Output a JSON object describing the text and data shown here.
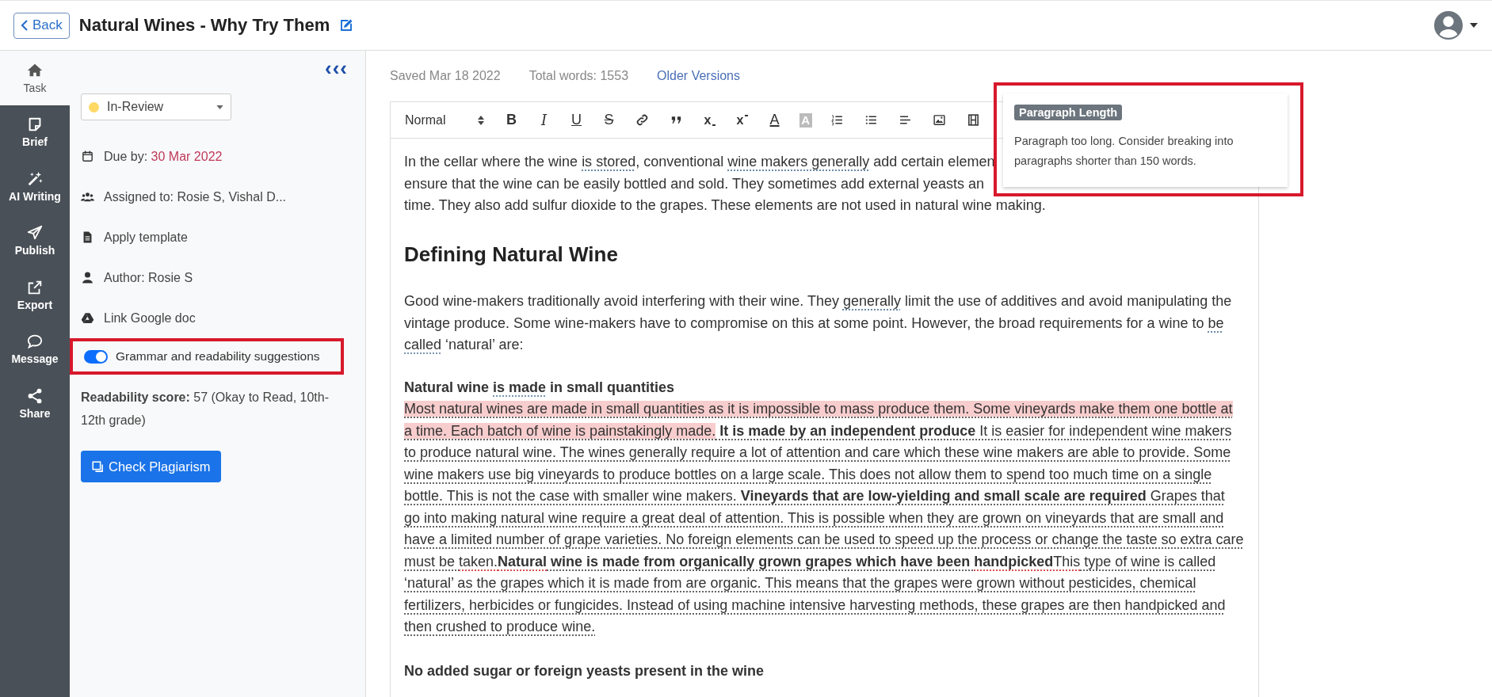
{
  "header": {
    "back_label": "Back",
    "title": "Natural Wines - Why Try Them"
  },
  "rail": [
    {
      "kind": "home",
      "label": "Task",
      "selected": true
    },
    {
      "kind": "note",
      "label": "Brief",
      "selected": false
    },
    {
      "kind": "wand",
      "label": "AI Writing",
      "selected": false
    },
    {
      "kind": "plane",
      "label": "Publish",
      "selected": false
    },
    {
      "kind": "export",
      "label": "Export",
      "selected": false
    },
    {
      "kind": "chat",
      "label": "Message",
      "selected": false
    },
    {
      "kind": "share",
      "label": "Share",
      "selected": false
    }
  ],
  "panel": {
    "collapse": "‹‹‹",
    "status": {
      "label": "In-Review",
      "color": "#ffd966"
    },
    "details": [
      {
        "kind": "calendar",
        "label": "Due by: ",
        "value": "30 Mar 2022"
      },
      {
        "kind": "users",
        "label": "Assigned to: Rosie S, Vishal D..."
      },
      {
        "kind": "file",
        "label": "Apply template"
      },
      {
        "kind": "user",
        "label": "Author: Rosie S"
      },
      {
        "kind": "drive",
        "label": "Link Google doc"
      }
    ],
    "suggestions": {
      "label": "Grammar and readability suggestions",
      "on": true,
      "framed": true
    },
    "readability": "**Readability score:** 57 (Okay to Read, 10th-12th grade)",
    "plagiarism_button": "Check Plagiarism"
  },
  "meta": {
    "saved": "Saved Mar 18 2022",
    "words": "Total words: 1553",
    "versions_link": "Older Versions"
  },
  "toolbar": [
    {
      "kind": "format",
      "label": "Normal"
    },
    {
      "kind": "bold",
      "glyph": "B"
    },
    {
      "kind": "italic",
      "glyph": "I"
    },
    {
      "kind": "underline",
      "glyph": "U"
    },
    {
      "kind": "strike",
      "glyph": "S"
    },
    {
      "kind": "link"
    },
    {
      "kind": "quote"
    },
    {
      "kind": "sub",
      "glyph": "x"
    },
    {
      "kind": "sup",
      "glyph": "x"
    },
    {
      "kind": "color",
      "glyph": "A"
    },
    {
      "kind": "background",
      "glyph": "A"
    },
    {
      "kind": "ol"
    },
    {
      "kind": "ul"
    },
    {
      "kind": "align"
    },
    {
      "kind": "image"
    },
    {
      "kind": "video"
    }
  ],
  "document": [
    {
      "kind": "lines",
      "segments": [
        {
          "kind": "plain",
          "text": "In the cellar where the wine "
        },
        {
          "kind": "hint",
          "text": "is stored"
        },
        {
          "kind": "plain",
          "text": ", conventional "
        },
        {
          "kind": "hint",
          "text": "wine makers generally"
        },
        {
          "kind": "plain",
          "text": " add certain elemen"
        },
        {
          "kind": "break"
        },
        {
          "kind": "plain",
          "text": "ensure that the wine can be easily bottled and sold. They sometimes add external yeasts an"
        },
        {
          "kind": "break"
        },
        {
          "kind": "plain",
          "text": "time. They also add sulfur dioxide to the grapes. These elements are not used in natural wine making."
        }
      ]
    },
    {
      "kind": "heading",
      "segments": [
        {
          "kind": "plain",
          "text": "Defining Natural Wine"
        }
      ]
    },
    {
      "kind": "paragraph",
      "underlined": false,
      "segments": [
        {
          "kind": "plain",
          "text": "Good wine-makers traditionally avoid interfering with their wine. They "
        },
        {
          "kind": "hint",
          "text": "generally"
        },
        {
          "kind": "plain",
          "text": " limit the use of additives and avoid manipulating the vintage produce. Some wine-makers have to compromise on this at some point. However, the broad requirements for a wine to "
        },
        {
          "kind": "hint",
          "text": "be called"
        },
        {
          "kind": "plain",
          "text": " ‘natural’ are:"
        }
      ]
    },
    {
      "kind": "subheading",
      "segments": [
        {
          "kind": "plain",
          "text": "Natural wine "
        },
        {
          "kind": "hint",
          "text": "is made"
        },
        {
          "kind": "plain",
          "text": " in small quantities"
        }
      ]
    },
    {
      "kind": "paragraph",
      "underlined": true,
      "segments": [
        {
          "kind": "highlight",
          "text": "Most natural wines are made in small quantities as it is impossible to mass produce them. Some vineyards make them one bottle at a time. Each batch of wine is painstakingly made."
        },
        {
          "kind": "bold",
          "text": " It is made by an independent produce"
        },
        {
          "kind": "plain",
          "text": " It is easier for independent wine makers to produce natural wine. The wines generally require a lot of attention and care which these wine makers are able to provide. Some wine makers use big vineyards to produce bottles on a large scale. This does not allow them to spend too much time on a single bottle. This is not the case with smaller wine makers. "
        },
        {
          "kind": "bold",
          "text": "Vineyards that are low-yielding and small scale are required"
        },
        {
          "kind": "plain",
          "text": " Grapes that go into making natural wine require a great deal of attention. This is possible when they are grown on vineyards that are small and have a limited number of grape varieties. No foreign elements can be used to speed up the process or change the taste so extra care must be "
        },
        {
          "kind": "error",
          "text": "taken."
        },
        {
          "kind": "bold-error",
          "text": "Natural"
        },
        {
          "kind": "bold",
          "text": " wine is made from organically grown grapes which have been "
        },
        {
          "kind": "bold-error",
          "text": "handpicked"
        },
        {
          "kind": "error",
          "text": "This"
        },
        {
          "kind": "plain",
          "text": " type of wine is called ‘natural’ as the grapes which it is made from are organic. This means that the grapes were grown without pesticides, chemical fertilizers, herbicides or fungicides. Instead of using machine intensive harvesting methods, these grapes are then handpicked and then crushed to produce wine."
        }
      ]
    },
    {
      "kind": "subheading",
      "segments": [
        {
          "kind": "plain",
          "text": "No added sugar or foreign yeasts present in the wine"
        }
      ]
    }
  ],
  "tooltip": {
    "tag": "Paragraph Length",
    "message": "Paragraph too long. Consider breaking into paragraphs shorter than 150 words.",
    "framed": true
  }
}
